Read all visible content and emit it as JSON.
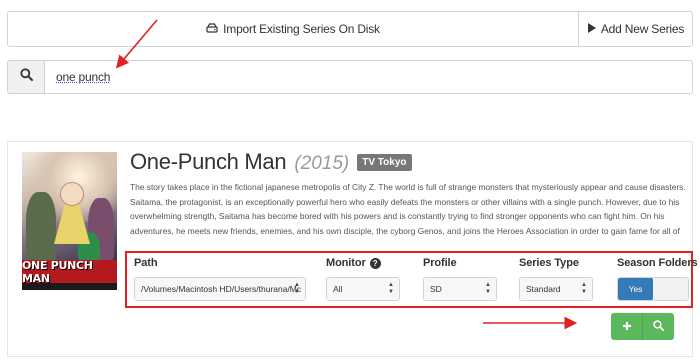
{
  "toolbar": {
    "import_label": "Import Existing Series On Disk",
    "add_label": "Add New Series"
  },
  "search": {
    "value": "one punch"
  },
  "result": {
    "title": "One-Punch Man",
    "year": "(2015)",
    "network": "TV Tokyo",
    "overview": "The story takes place in the fictional japanese metropolis of City Z. The world is full of strange monsters that mysteriously appear and cause disasters. Saitama, the protagonist, is an exceptionally powerful hero who easily defeats the monsters or other villains with a single punch. However, due to his overwhelming strength, Saitama has become bored with his powers and is constantly trying to find stronger opponents who can fight him. On his adventures, he meets new friends, enemies, and his own disciple, the cyborg Genos, and joins the Heroes Association in order to gain fame for all of his efforts to defeat evil. Despite defeating many strong monsters that",
    "poster_text": "ONE PUNCH MAN"
  },
  "options": {
    "path_label": "Path",
    "path_value": "/Volumes/Macintosh HD/Users/thurana/Mc",
    "monitor_label": "Monitor",
    "monitor_value": "All",
    "profile_label": "Profile",
    "profile_value": "SD",
    "series_type_label": "Series Type",
    "series_type_value": "Standard",
    "season_folders_label": "Season Folders",
    "season_folders_value": "Yes"
  },
  "colors": {
    "accent_blue": "#337ab7",
    "success_green": "#5cb85c",
    "annotation_red": "#e02222",
    "network_badge": "#777777"
  },
  "icons": {
    "import": "hard-drive-icon",
    "add": "play-icon",
    "search": "search-icon",
    "help": "question-circle-icon",
    "add_series": "plus-icon",
    "search_series": "search-icon"
  }
}
